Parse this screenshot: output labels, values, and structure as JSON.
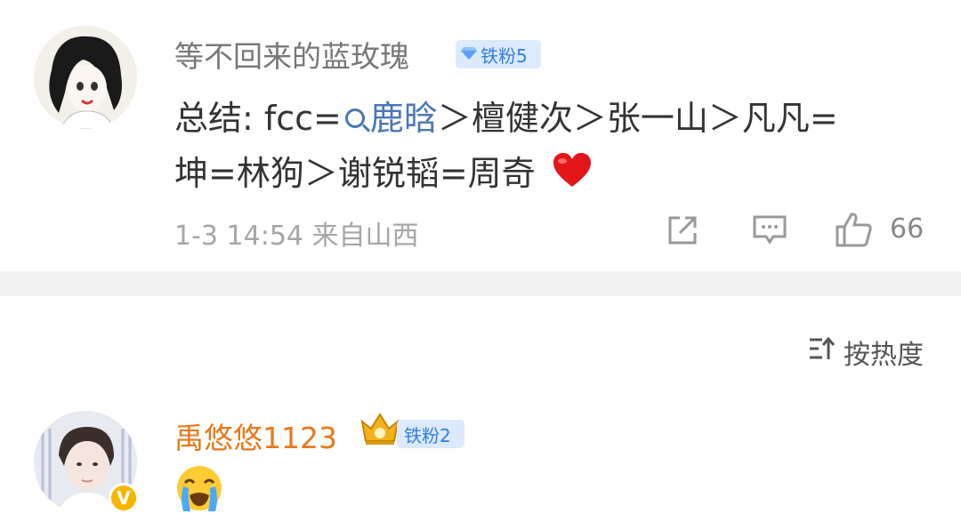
{
  "comment1": {
    "username": "等不回来的蓝玫瑰",
    "badge": "铁粉5",
    "content_line1_prefix": "总结: fcc=",
    "content_topic": "鹿晗",
    "content_line1_suffix": "＞檀健次＞张一山＞凡凡=",
    "content_line2": "坤=林狗＞谢锐韬=周奇",
    "meta": "1-3 14:54  来自山西",
    "like_count": "66"
  },
  "sort": {
    "label": "按热度"
  },
  "comment2": {
    "username": "禹悠悠1123",
    "badge": "铁粉2",
    "verified_mark": "V"
  },
  "colors": {
    "username_gray": "#777777",
    "topic_blue": "#4a77b4",
    "badge_blue": "#2f7fe6",
    "badge_bg": "#dbeafc",
    "orange_name": "#e8781a",
    "divider": "#f2f2f2"
  },
  "icons": [
    "share-icon",
    "reply-icon",
    "like-icon",
    "sort-icon",
    "heart-emoji",
    "crying-emoji",
    "crown-icon",
    "diamond-icon"
  ]
}
